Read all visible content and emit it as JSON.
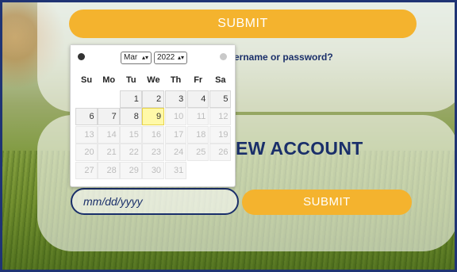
{
  "form": {
    "top_submit": "SUBMIT",
    "forgot_text": "ername or password?",
    "new_account_heading": "EW ACCOUNT",
    "date_placeholder": "mm/dd/yyyy",
    "bottom_submit": "SUBMIT"
  },
  "calendar": {
    "month": "Mar",
    "year": "2022",
    "weekdays": [
      "Su",
      "Mo",
      "Tu",
      "We",
      "Th",
      "Fr",
      "Sa"
    ],
    "weeks": [
      [
        "",
        "",
        "1",
        "2",
        "3",
        "4",
        "5"
      ],
      [
        "6",
        "7",
        "8",
        "9",
        "10",
        "11",
        "12"
      ],
      [
        "13",
        "14",
        "15",
        "16",
        "17",
        "18",
        "19"
      ],
      [
        "20",
        "21",
        "22",
        "23",
        "24",
        "25",
        "26"
      ],
      [
        "27",
        "28",
        "29",
        "30",
        "31",
        "",
        ""
      ]
    ],
    "today": "9"
  },
  "colors": {
    "accent": "#f4b32e",
    "text_primary": "#1a2f6a"
  }
}
